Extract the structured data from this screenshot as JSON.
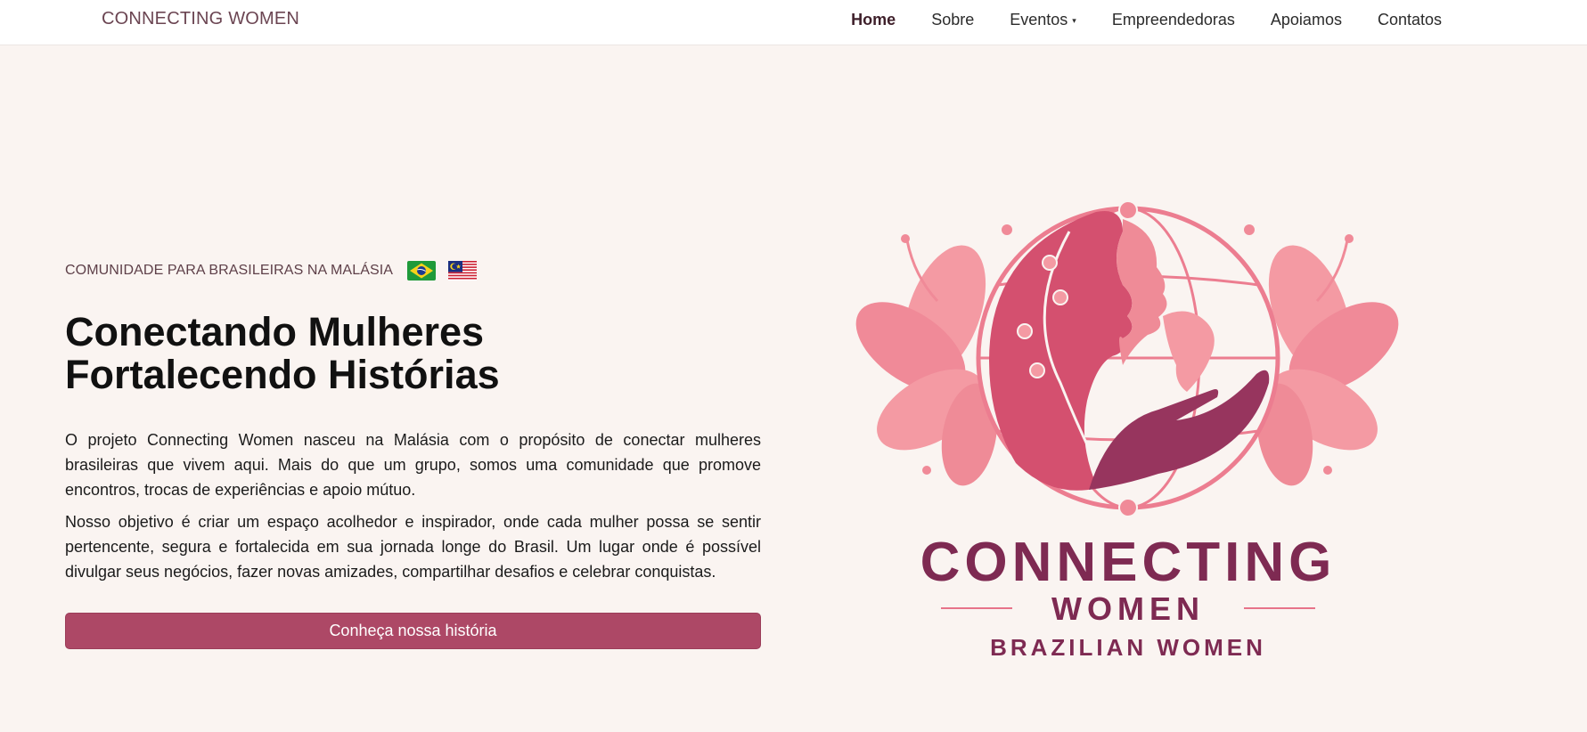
{
  "navbar": {
    "brand": "CONNECTING WOMEN",
    "items": [
      {
        "label": "Home",
        "active": true
      },
      {
        "label": "Sobre"
      },
      {
        "label": "Eventos",
        "has_dropdown": true
      },
      {
        "label": "Empreendedoras"
      },
      {
        "label": "Apoiamos"
      },
      {
        "label": "Contatos"
      }
    ]
  },
  "hero": {
    "eyebrow": "COMUNIDADE PARA BRASILEIRAS NA MALÁSIA",
    "flags": [
      "brazil-flag",
      "malaysia-flag"
    ],
    "title_line1": "Conectando Mulheres",
    "title_line2": "Fortalecendo Histórias",
    "paragraph1": "O projeto Connecting Women nasceu na Malásia com o propósito de conectar mulheres brasileiras que vivem aqui. Mais do que um grupo, somos uma comunidade que promove encontros, trocas de experiências e apoio mútuo.",
    "paragraph2": "Nosso objetivo é criar um espaço acolhedor e inspirador, onde cada mulher possa se sentir pertencente, segura e fortalecida em sua jornada longe do Brasil. Um lugar onde é possível divulgar seus negócios, fazer novas amizades, compartilhar desafios e celebrar conquistas.",
    "cta_label": "Conheça nossa história"
  },
  "logo": {
    "line1": "CONNECTING",
    "line2": "WOMEN",
    "line3": "BRAZILIAN WOMEN"
  },
  "colors": {
    "background": "#faf4f1",
    "accent": "#ad4866",
    "logo_text": "#7e2a52",
    "logo_pink": "#e7738a",
    "logo_light_pink": "#f49aa3"
  }
}
